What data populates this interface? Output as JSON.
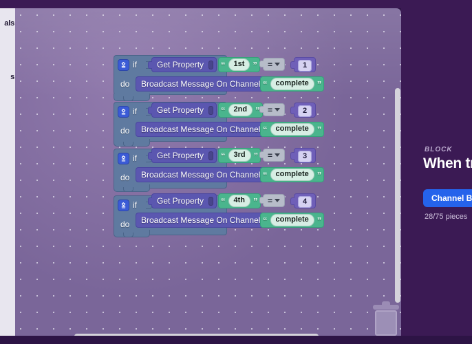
{
  "app": {
    "accent_blue": "#2563eb",
    "canvas_bg": "#7a6699",
    "panel_bg": "#3b1a54"
  },
  "sidebar": {
    "items": [
      {
        "label": "als"
      },
      {
        "label": "s"
      }
    ]
  },
  "workspace": {
    "trash_name": "trash-can",
    "blocks": [
      {
        "if_keyword": "if",
        "do_keyword": "do",
        "condition": {
          "getter_label": "Get Property",
          "string_value": "1st",
          "operator": "=",
          "number_value": "1"
        },
        "action": {
          "label": "Broadcast Message On Channel",
          "channel": "complete"
        }
      },
      {
        "if_keyword": "if",
        "do_keyword": "do",
        "condition": {
          "getter_label": "Get Property",
          "string_value": "2nd",
          "operator": "=",
          "number_value": "2"
        },
        "action": {
          "label": "Broadcast Message On Channel",
          "channel": "complete"
        }
      },
      {
        "if_keyword": "if",
        "do_keyword": "do",
        "condition": {
          "getter_label": "Get Property",
          "string_value": "3rd",
          "operator": "=",
          "number_value": "3"
        },
        "action": {
          "label": "Broadcast Message On Channel",
          "channel": "complete"
        }
      },
      {
        "if_keyword": "if",
        "do_keyword": "do",
        "condition": {
          "getter_label": "Get Property",
          "string_value": "4th",
          "operator": "=",
          "number_value": "4"
        },
        "action": {
          "label": "Broadcast Message On Channel",
          "channel": "complete"
        }
      }
    ]
  },
  "panel": {
    "kicker": "BLOCK",
    "title": "When tr",
    "button_label": "Channel Br",
    "pieces_count": "28/75 pieces"
  },
  "quotes": {
    "open": "“",
    "close": "”"
  }
}
